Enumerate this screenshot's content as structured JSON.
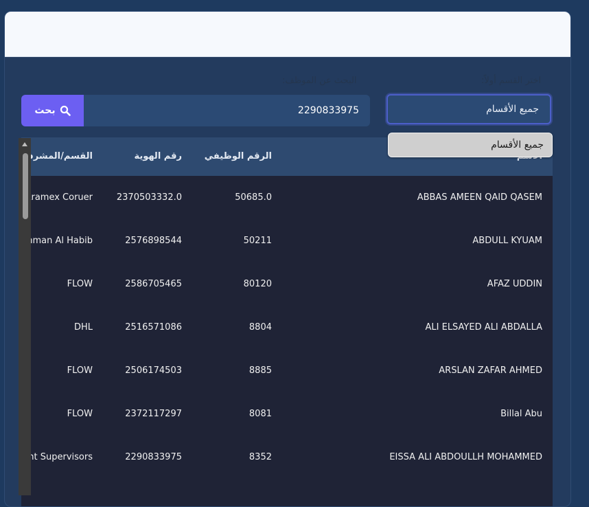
{
  "filters": {
    "department_label": "اختر القسم أولاً:",
    "department_selected": "جميع الأقسام",
    "department_options": [
      "جميع الأقسام"
    ],
    "search_label": "البحث عن الموظف:",
    "search_value": "2290833975",
    "search_button": "بحث"
  },
  "table": {
    "headers": {
      "department": "القسم/المشرف",
      "id_number": "رقم الهوية",
      "employee_number": "الرقم الوظيفي",
      "name": "الاسم"
    },
    "rows": [
      {
        "name": "ABBAS AMEEN QAID QASEM",
        "employee_number": "50685.0",
        "id_number": "2370503332.0",
        "department": "Aramex Coruer"
      },
      {
        "name": "ABDULL KYUAM",
        "employee_number": "50211",
        "id_number": "2576898544",
        "department": "Othman Al Habib"
      },
      {
        "name": "AFAZ UDDIN",
        "employee_number": "80120",
        "id_number": "2586705465",
        "department": "FLOW"
      },
      {
        "name": "ALI ELSAYED ALI ABDALLA",
        "employee_number": "8804",
        "id_number": "2516571086",
        "department": "DHL"
      },
      {
        "name": "ARSLAN ZAFAR AHMED",
        "employee_number": "8885",
        "id_number": "2506174503",
        "department": "FLOW"
      },
      {
        "name": "Billal Abu",
        "employee_number": "8081",
        "id_number": "2372117297",
        "department": "FLOW"
      },
      {
        "name": "EISSA ALI ABDOULLH MOHAMMED",
        "employee_number": "8352",
        "id_number": "2290833975",
        "department": "Restaurant Supervisors"
      }
    ]
  }
}
